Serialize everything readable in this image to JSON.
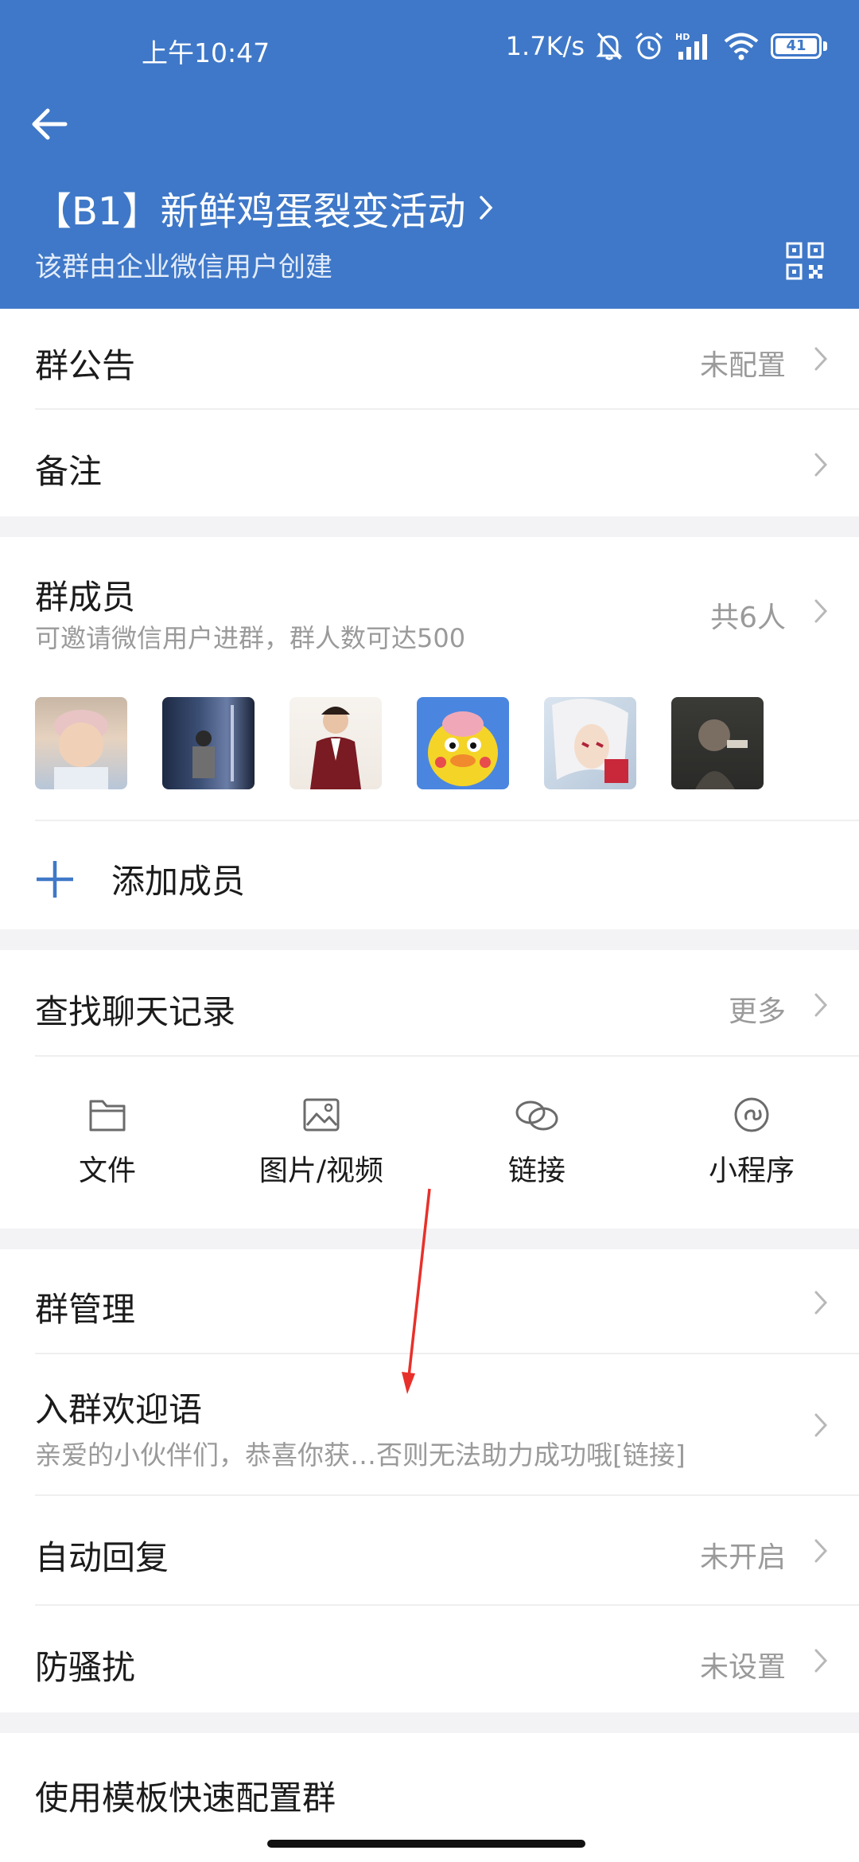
{
  "status_bar": {
    "time": "上午10:47",
    "net_speed": "1.7K/s",
    "battery": "41"
  },
  "header": {
    "title": "【B1】新鲜鸡蛋裂变活动",
    "subtitle": "该群由企业微信用户创建",
    "bg_color": "#3f78c8"
  },
  "rows": {
    "announcement": {
      "label": "群公告",
      "value": "未配置"
    },
    "remark": {
      "label": "备注"
    },
    "members": {
      "label": "群成员",
      "sub": "可邀请微信用户进群，群人数可达500",
      "count": "共6人"
    },
    "add_member": {
      "label": "添加成员"
    },
    "search_history": {
      "label": "查找聊天记录",
      "value": "更多"
    },
    "group_manage": {
      "label": "群管理"
    },
    "welcome": {
      "label": "入群欢迎语",
      "sub": "亲爱的小伙伴们，恭喜你获…否则无法助力成功哦[链接]"
    },
    "auto_reply": {
      "label": "自动回复",
      "value": "未开启"
    },
    "anti_harass": {
      "label": "防骚扰",
      "value": "未设置"
    },
    "template": {
      "label": "使用模板快速配置群"
    }
  },
  "quick_actions": [
    {
      "label": "文件",
      "icon": "folder-icon"
    },
    {
      "label": "图片/视频",
      "icon": "image-icon"
    },
    {
      "label": "链接",
      "icon": "link-icon"
    },
    {
      "label": "小程序",
      "icon": "mini-program-icon"
    }
  ],
  "member_avatars": [
    {
      "icon": "avatar-child"
    },
    {
      "icon": "avatar-backpack"
    },
    {
      "icon": "avatar-man-suit"
    },
    {
      "icon": "avatar-yellow-duck"
    },
    {
      "icon": "avatar-anime"
    },
    {
      "icon": "avatar-dark"
    }
  ],
  "colors": {
    "accent": "#3f78c8",
    "annotation_arrow": "#e8302a"
  }
}
